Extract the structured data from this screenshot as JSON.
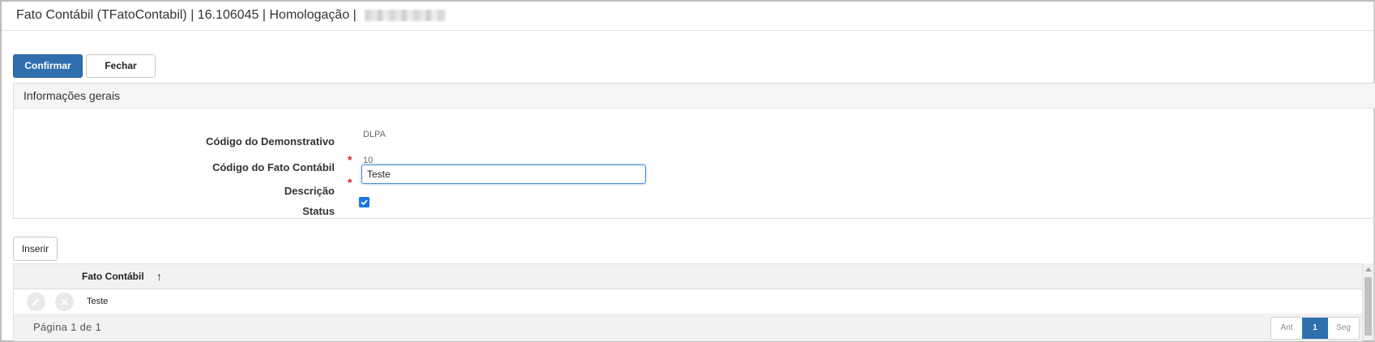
{
  "window": {
    "title": "Fato Contábil (TFatoContabil) | 16.106045 | Homologação |"
  },
  "toolbar": {
    "confirm_label": "Confirmar",
    "close_label": "Fechar"
  },
  "general_info": {
    "header": "Informações gerais",
    "fields": {
      "demonstrativo_label": "Código do Demonstrativo",
      "demonstrativo_value": "DLPA",
      "fato_label": "Código do Fato Contábil",
      "fato_value": "10",
      "descricao_label": "Descrição",
      "descricao_value": "Teste",
      "status_label": "Status",
      "status_checked": true
    },
    "required_marker": "*"
  },
  "grid": {
    "insert_label": "Inserir",
    "column_header": "Fato Contábil",
    "sort_indicator": "↑",
    "rows": [
      {
        "fato_contabil": "Teste"
      }
    ],
    "page_info": "Página 1 de 1",
    "pager": {
      "prev": "Ant",
      "current": "1",
      "next": "Seg"
    }
  },
  "icons": {
    "edit": "pencil-icon",
    "delete": "close-icon",
    "sort": "arrow-up-icon",
    "checkbox": "checkmark-icon"
  },
  "colors": {
    "primary": "#2f6fae",
    "required": "#d9232d",
    "focus": "#4a8ed8",
    "checkbox": "#1a73e8"
  }
}
